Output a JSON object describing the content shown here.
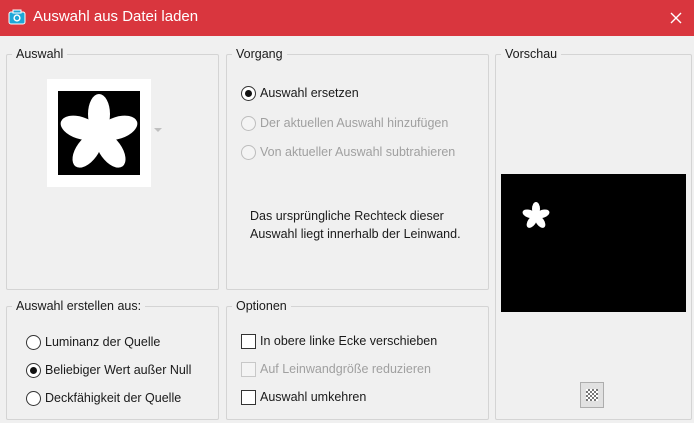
{
  "window": {
    "title": "Auswahl aus Datei laden",
    "accent": "#d9363e",
    "icon": "camera-icon"
  },
  "auswahl": {
    "legend": "Auswahl",
    "thumbnail": "flower-selection-thumbnail"
  },
  "vorgang": {
    "legend": "Vorgang",
    "options": [
      {
        "label": "Auswahl ersetzen",
        "checked": true,
        "enabled": true
      },
      {
        "label": "Der aktuellen Auswahl hinzufügen",
        "checked": false,
        "enabled": false
      },
      {
        "label": "Von aktueller Auswahl subtrahieren",
        "checked": false,
        "enabled": false
      }
    ],
    "info": "Das ursprüngliche Rechteck dieser Auswahl liegt innerhalb der Leinwand."
  },
  "vorschau": {
    "legend": "Vorschau",
    "transparency_button": "checkerboard-icon"
  },
  "erstellen": {
    "legend": "Auswahl erstellen aus:",
    "options": [
      {
        "label": "Luminanz der Quelle",
        "checked": false
      },
      {
        "label": "Beliebiger Wert außer Null",
        "checked": true
      },
      {
        "label": "Deckfähigkeit der Quelle",
        "checked": false
      }
    ]
  },
  "optionen": {
    "legend": "Optionen",
    "checks": [
      {
        "label": "In obere linke Ecke verschieben",
        "checked": false,
        "enabled": true
      },
      {
        "label": "Auf Leinwandgröße reduzieren",
        "checked": false,
        "enabled": false
      },
      {
        "label": "Auswahl umkehren",
        "checked": false,
        "enabled": true
      }
    ]
  }
}
